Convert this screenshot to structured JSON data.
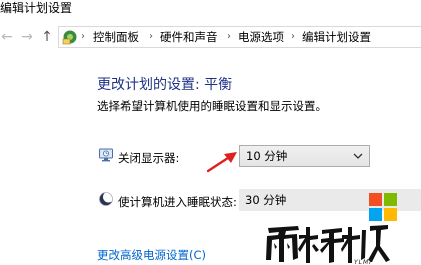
{
  "window": {
    "title": "编辑计划设置"
  },
  "nav": {
    "back_glyph": "←",
    "forward_glyph": "→",
    "up_glyph": "↑",
    "address_icon": "control-panel-icon",
    "breadcrumb": [
      "控制面板",
      "硬件和声音",
      "电源选项",
      "编辑计划设置"
    ],
    "separator": "›"
  },
  "main": {
    "heading": "更改计划的设置: 平衡",
    "description": "选择希望计算机使用的睡眠设置和显示设置。",
    "settings": [
      {
        "icon": "display-off-icon",
        "label": "关闭显示器:",
        "value": "10 分钟"
      },
      {
        "icon": "sleep-moon-icon",
        "label": "使计算机进入睡眠状态:",
        "value": "30 分钟"
      }
    ],
    "advanced_link": "更改高级电源设置(C)"
  },
  "watermark": {
    "text": "雨林木风",
    "subtext": "YLMF"
  },
  "colors": {
    "heading": "#1e3287",
    "link": "#0066cc",
    "annotation_arrow": "#e02020"
  }
}
